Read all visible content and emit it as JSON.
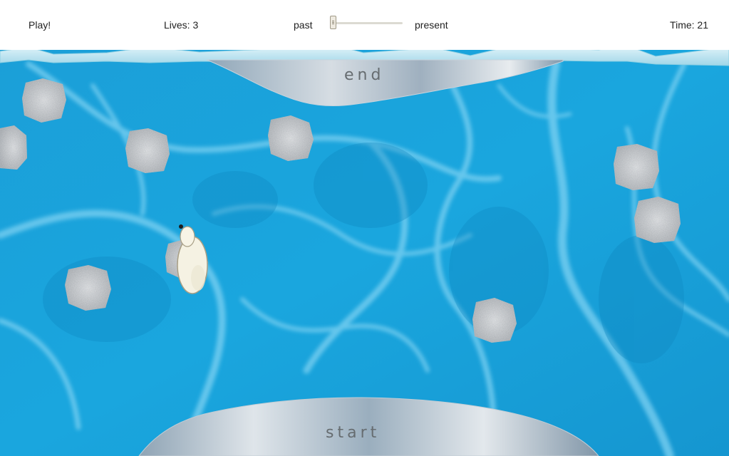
{
  "hud": {
    "play_label": "Play!",
    "lives_text": "Lives: 3",
    "past_label": "past",
    "present_label": "present",
    "time_text": "Time: 21",
    "timeline_position": 0.0
  },
  "zones": {
    "end_label": "end",
    "start_label": "start"
  },
  "colors": {
    "water": "#1ba3dc",
    "water_light": "#74cdf0",
    "water_dark": "#0f8cc6",
    "ice_edge": "#bfe6f1",
    "ice_floe": "#c9ccd0",
    "landing_ice": "#a9b9c6",
    "bear": "#f5f2e3"
  },
  "game": {
    "ice_floe_count": 10
  }
}
